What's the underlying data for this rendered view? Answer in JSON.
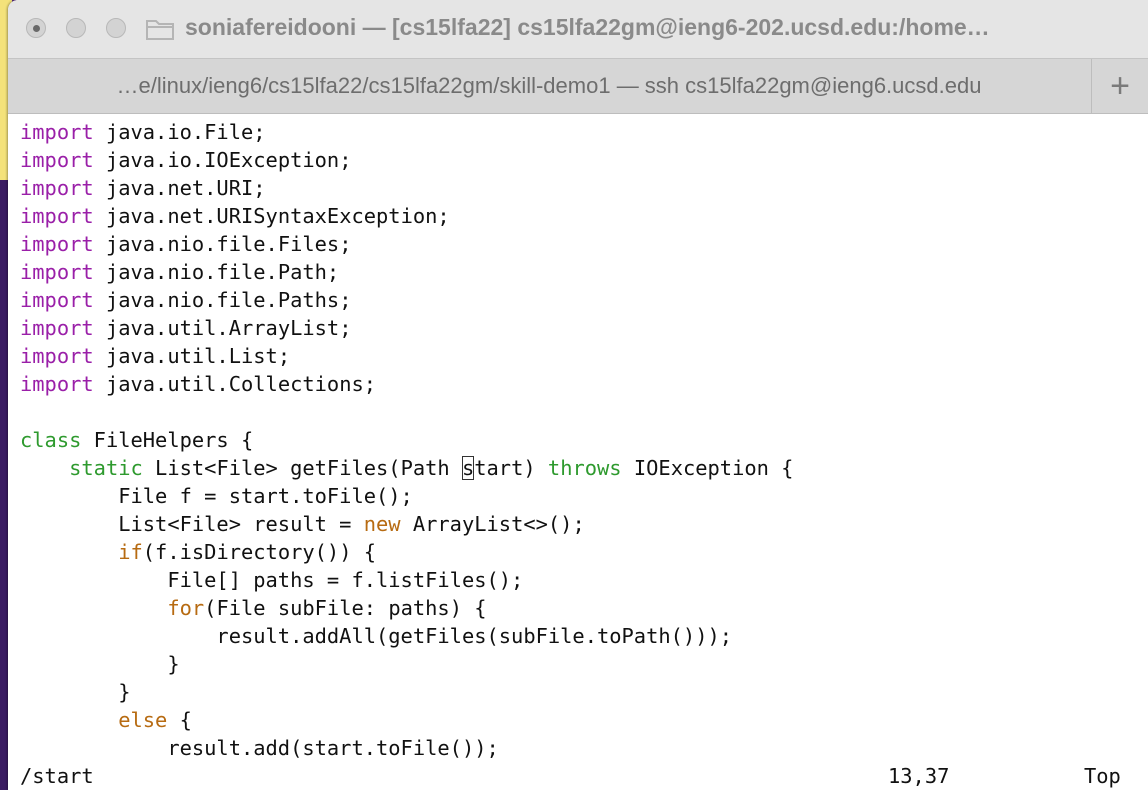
{
  "window": {
    "title": "soniafereidooni — [cs15lfa22]  cs15lfa22gm@ieng6-202.ucsd.edu:/home…"
  },
  "tab": {
    "label": "…e/linux/ieng6/cs15lfa22/cs15lfa22gm/skill-demo1 — ssh cs15lfa22gm@ieng6.ucsd.edu",
    "add_label": "+"
  },
  "editor": {
    "lines": [
      [
        {
          "t": "import",
          "c": "kw"
        },
        {
          "t": " java.io.File;"
        }
      ],
      [
        {
          "t": "import",
          "c": "kw"
        },
        {
          "t": " java.io.IOException;"
        }
      ],
      [
        {
          "t": "import",
          "c": "kw"
        },
        {
          "t": " java.net.URI;"
        }
      ],
      [
        {
          "t": "import",
          "c": "kw"
        },
        {
          "t": " java.net.URISyntaxException;"
        }
      ],
      [
        {
          "t": "import",
          "c": "kw"
        },
        {
          "t": " java.nio.file.Files;"
        }
      ],
      [
        {
          "t": "import",
          "c": "kw"
        },
        {
          "t": " java.nio.file.Path;"
        }
      ],
      [
        {
          "t": "import",
          "c": "kw"
        },
        {
          "t": " java.nio.file.Paths;"
        }
      ],
      [
        {
          "t": "import",
          "c": "kw"
        },
        {
          "t": " java.util.ArrayList;"
        }
      ],
      [
        {
          "t": "import",
          "c": "kw"
        },
        {
          "t": " java.util.List;"
        }
      ],
      [
        {
          "t": "import",
          "c": "kw"
        },
        {
          "t": " java.util.Collections;"
        }
      ],
      [],
      [
        {
          "t": "class",
          "c": "ty"
        },
        {
          "t": " FileHelpers {"
        }
      ],
      [
        {
          "t": "    "
        },
        {
          "t": "static",
          "c": "ty"
        },
        {
          "t": " List<File> getFiles(Path "
        },
        {
          "t": "s",
          "c": "cursor"
        },
        {
          "t": "tart) "
        },
        {
          "t": "throws",
          "c": "ty"
        },
        {
          "t": " IOException {"
        }
      ],
      [
        {
          "t": "        File f = start.toFile();"
        }
      ],
      [
        {
          "t": "        List<File> result = "
        },
        {
          "t": "new",
          "c": "ctl"
        },
        {
          "t": " ArrayList<>();"
        }
      ],
      [
        {
          "t": "        "
        },
        {
          "t": "if",
          "c": "ctl"
        },
        {
          "t": "(f.isDirectory()) {"
        }
      ],
      [
        {
          "t": "            File[] paths = f.listFiles();"
        }
      ],
      [
        {
          "t": "            "
        },
        {
          "t": "for",
          "c": "ctl"
        },
        {
          "t": "(File subFile: paths) {"
        }
      ],
      [
        {
          "t": "                result.addAll(getFiles(subFile.toPath()));"
        }
      ],
      [
        {
          "t": "            }"
        }
      ],
      [
        {
          "t": "        }"
        }
      ],
      [
        {
          "t": "        "
        },
        {
          "t": "else",
          "c": "ctl"
        },
        {
          "t": " {"
        }
      ],
      [
        {
          "t": "            result.add(start.toFile());"
        }
      ]
    ]
  },
  "status": {
    "command": "/start",
    "position": "13,37",
    "scroll": "Top"
  },
  "colors": {
    "keyword_import": "#9a1fa8",
    "keyword_type": "#2e9a2e",
    "keyword_control": "#b76b12"
  }
}
